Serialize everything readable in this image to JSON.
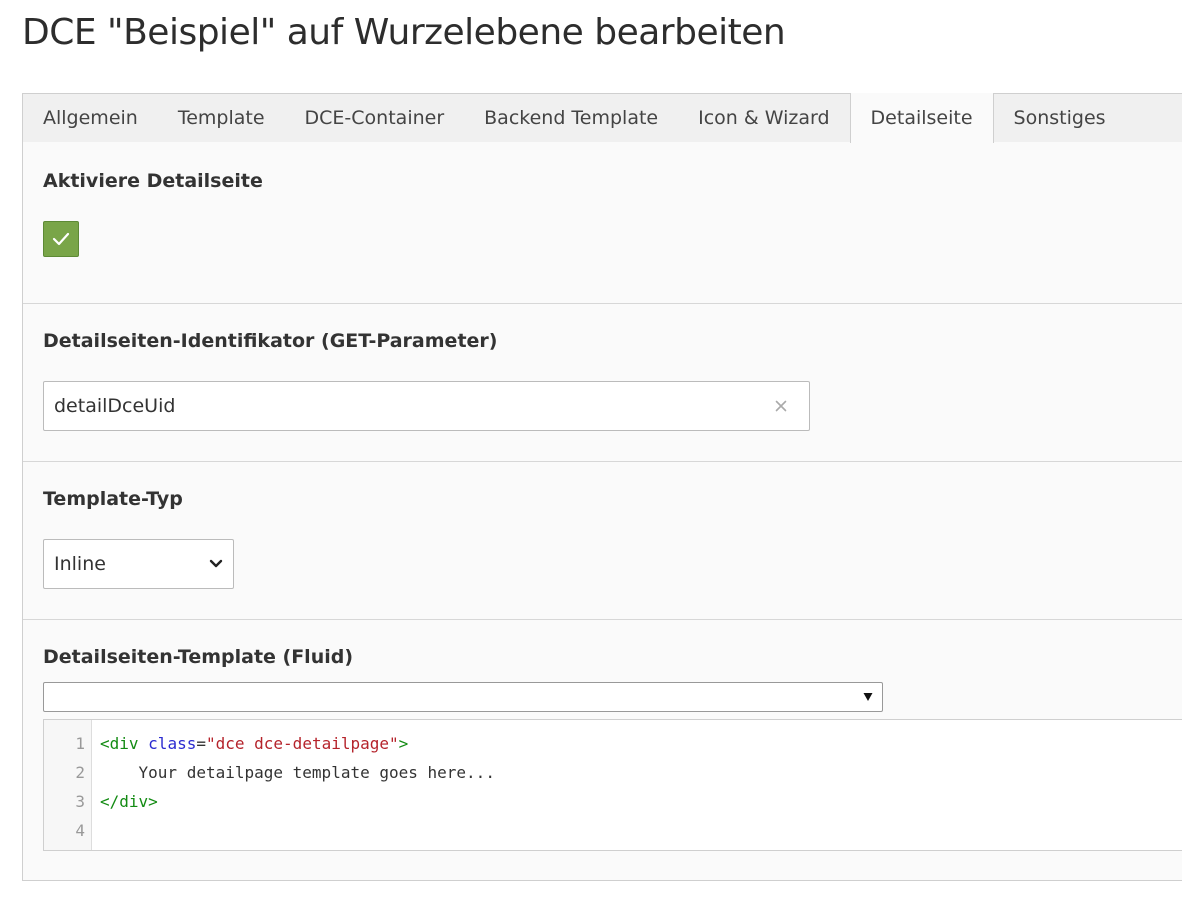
{
  "page": {
    "title": "DCE \"Beispiel\" auf Wurzelebene bearbeiten"
  },
  "tabs": [
    {
      "label": "Allgemein",
      "active": false
    },
    {
      "label": "Template",
      "active": false
    },
    {
      "label": "DCE-Container",
      "active": false
    },
    {
      "label": "Backend Template",
      "active": false
    },
    {
      "label": "Icon & Wizard",
      "active": false
    },
    {
      "label": "Detailseite",
      "active": true
    },
    {
      "label": "Sonstiges",
      "active": false
    }
  ],
  "fields": {
    "enable_detailpage": {
      "label": "Aktiviere Detailseite",
      "checked": true,
      "icon": "check-icon"
    },
    "identifier": {
      "label": "Detailseiten-Identifikator (GET-Parameter)",
      "value": "detailDceUid",
      "clear_icon": "close-icon"
    },
    "template_type": {
      "label": "Template-Typ",
      "selected": "Inline",
      "icon": "chevron-down-icon"
    },
    "template": {
      "label": "Detailseiten-Template (Fluid)",
      "preset_selected": "",
      "preset_icon": "caret-down-icon",
      "code": {
        "line_numbers": [
          "1",
          "2",
          "3",
          "4"
        ],
        "line1_open": "<div",
        "line1_space": " ",
        "line1_attr": "class",
        "line1_eq": "=",
        "line1_str": "\"dce dce-detailpage\"",
        "line1_close": ">",
        "line2": "    Your detailpage template goes here...",
        "line3": "</div>",
        "line4": ""
      }
    }
  },
  "colors": {
    "checkbox_green": "#79a548",
    "code_tag": "#138b13",
    "code_attr": "#2b2bd0",
    "code_string": "#b5232b"
  }
}
